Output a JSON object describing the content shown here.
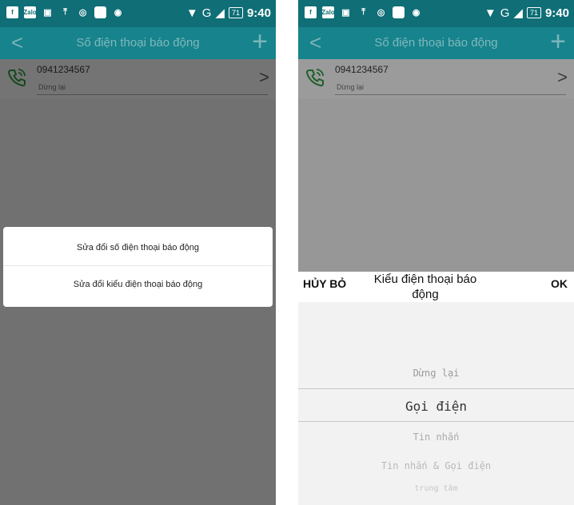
{
  "status_bar": {
    "network": "G",
    "battery": "71",
    "time": "9:40",
    "icons": [
      "facebook-icon",
      "zalo-icon",
      "image-icon",
      "upload-icon",
      "chrome-icon",
      "square-icon",
      "eye-icon"
    ]
  },
  "app_bar": {
    "title": "Số điện thoại báo động"
  },
  "contact": {
    "number": "0941234567",
    "status": "Dừng lại"
  },
  "dialog": {
    "option1": "Sửa đổi số điện thoại báo động",
    "option2": "Sửa đổi kiểu điện thoại báo động"
  },
  "picker": {
    "cancel": "HỦY BỎ",
    "title": "Kiểu điện thoại báo động",
    "ok": "OK",
    "options": [
      "Dừng lại",
      "Gọi điện",
      "Tin nhắn",
      "Tin nhắn & Gọi điện",
      "trung tâm"
    ],
    "selected": "Gọi điện"
  },
  "colors": {
    "status_bar": "#0f6e76",
    "app_bar": "#17838c",
    "accent_icon": "#2a8a3a"
  }
}
